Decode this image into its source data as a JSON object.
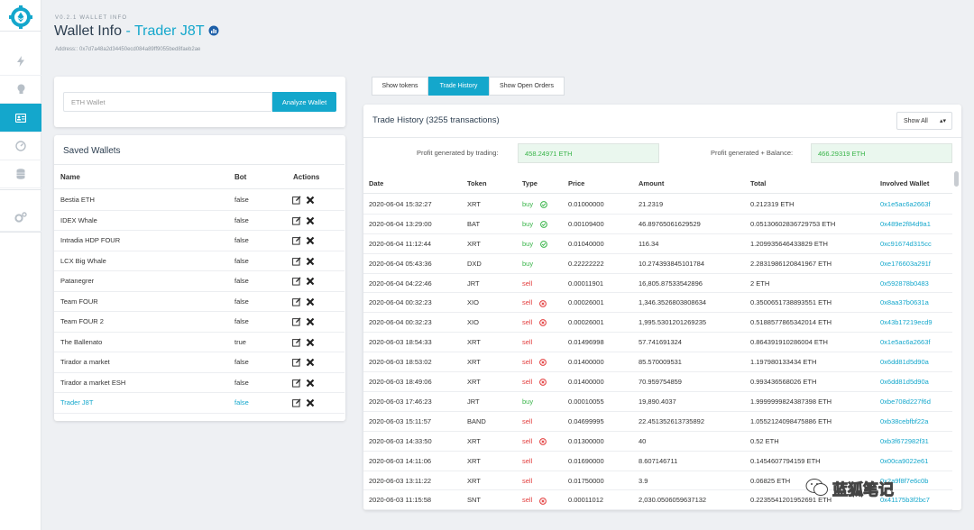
{
  "header": {
    "version": "V0.2.1 WALLET INFO",
    "title_prefix": "Wallet Info",
    "title_accent": "- Trader J8T",
    "address": "Address:: 0x7d7a48a2d34450ecd084a89ff9055bed8faeb2ae"
  },
  "sidebar": {
    "items": [
      {
        "icon": "bolt-icon"
      },
      {
        "icon": "bulb-icon"
      },
      {
        "icon": "wallet-card-icon",
        "active": true
      },
      {
        "icon": "gauge-icon"
      },
      {
        "icon": "database-icon"
      },
      {
        "icon": "gears-icon"
      }
    ]
  },
  "analyze": {
    "placeholder": "ETH Wallet",
    "button_label": "Analyze Wallet"
  },
  "saved_wallets": {
    "title": "Saved Wallets",
    "columns": [
      "Name",
      "Bot",
      "Actions"
    ],
    "rows": [
      {
        "name": "Bestia ETH",
        "bot": "false"
      },
      {
        "name": "IDEX Whale",
        "bot": "false"
      },
      {
        "name": "Intradia HDP FOUR",
        "bot": "false"
      },
      {
        "name": "LCX Big Whale",
        "bot": "false"
      },
      {
        "name": "Patanegrer",
        "bot": "false"
      },
      {
        "name": "Team FOUR",
        "bot": "false"
      },
      {
        "name": "Team FOUR 2",
        "bot": "false"
      },
      {
        "name": "The Ballenato",
        "bot": "true"
      },
      {
        "name": "Tirador a market",
        "bot": "false"
      },
      {
        "name": "Tirador a market ESH",
        "bot": "false"
      },
      {
        "name": "Trader J8T",
        "bot": "false",
        "selected": true
      }
    ]
  },
  "tabs": [
    {
      "label": "Show tokens"
    },
    {
      "label": "Trade History",
      "active": true
    },
    {
      "label": "Show Open Orders"
    }
  ],
  "trade_history": {
    "title": "Trade History (3255 transactions)",
    "filter": "Show All",
    "profit_trading_label": "Profit generated by trading:",
    "profit_trading_value": "458.24971 ETH",
    "profit_balance_label": "Profit generated + Balance:",
    "profit_balance_value": "466.29319 ETH",
    "columns": [
      "Date",
      "Token",
      "Type",
      "Price",
      "Amount",
      "Total",
      "Involved Wallet"
    ],
    "rows": [
      {
        "date": "2020-06-04 15:32:27",
        "token": "XRT",
        "type": "buy",
        "icon": "ok",
        "price": "0.01000000",
        "amount": "21.2319",
        "total": "0.212319 ETH",
        "wallet": "0x1e5ac6a2663f"
      },
      {
        "date": "2020-06-04 13:29:00",
        "token": "BAT",
        "type": "buy",
        "icon": "ok",
        "price": "0.00109400",
        "amount": "46.89765061629529",
        "total": "0.05130602836729753 ETH",
        "wallet": "0x489e2f84d9a1"
      },
      {
        "date": "2020-06-04 11:12:44",
        "token": "XRT",
        "type": "buy",
        "icon": "ok",
        "price": "0.01040000",
        "amount": "116.34",
        "total": "1.209935646433829 ETH",
        "wallet": "0xc91674d315cc"
      },
      {
        "date": "2020-06-04 05:43:36",
        "token": "DXD",
        "type": "buy",
        "icon": "",
        "price": "0.22222222",
        "amount": "10.274393845101784",
        "total": "2.2831986120841967 ETH",
        "wallet": "0xe176603a291f"
      },
      {
        "date": "2020-06-04 04:22:46",
        "token": "JRT",
        "type": "sell",
        "icon": "",
        "price": "0.00011901",
        "amount": "16,805.87533542896",
        "total": "2 ETH",
        "wallet": "0x592878b0483"
      },
      {
        "date": "2020-06-04 00:32:23",
        "token": "XIO",
        "type": "sell",
        "icon": "x",
        "price": "0.00026001",
        "amount": "1,346.3526803808634",
        "total": "0.3500651738893551 ETH",
        "wallet": "0x8aa37b0631a"
      },
      {
        "date": "2020-06-04 00:32:23",
        "token": "XIO",
        "type": "sell",
        "icon": "x",
        "price": "0.00026001",
        "amount": "1,995.5301201269235",
        "total": "0.5188577865342014 ETH",
        "wallet": "0x43b17219ecd9"
      },
      {
        "date": "2020-06-03 18:54:33",
        "token": "XRT",
        "type": "sell",
        "icon": "",
        "price": "0.01496998",
        "amount": "57.741691324",
        "total": "0.864391910286004 ETH",
        "wallet": "0x1e5ac6a2663f"
      },
      {
        "date": "2020-06-03 18:53:02",
        "token": "XRT",
        "type": "sell",
        "icon": "x",
        "price": "0.01400000",
        "amount": "85.570009531",
        "total": "1.197980133434 ETH",
        "wallet": "0x6dd81d5d90a"
      },
      {
        "date": "2020-06-03 18:49:06",
        "token": "XRT",
        "type": "sell",
        "icon": "x",
        "price": "0.01400000",
        "amount": "70.959754859",
        "total": "0.993436568026 ETH",
        "wallet": "0x6dd81d5d90a"
      },
      {
        "date": "2020-06-03 17:46:23",
        "token": "JRT",
        "type": "buy",
        "icon": "",
        "price": "0.00010055",
        "amount": "19,890.4037",
        "total": "1.9999999824387398 ETH",
        "wallet": "0xbe708d227f6d"
      },
      {
        "date": "2020-06-03 15:11:57",
        "token": "BAND",
        "type": "sell",
        "icon": "",
        "price": "0.04699995",
        "amount": "22.451352613735892",
        "total": "1.0552124098475886 ETH",
        "wallet": "0xb38cebfbf22a"
      },
      {
        "date": "2020-06-03 14:33:50",
        "token": "XRT",
        "type": "sell",
        "icon": "x",
        "price": "0.01300000",
        "amount": "40",
        "total": "0.52 ETH",
        "wallet": "0xb3f672982f31"
      },
      {
        "date": "2020-06-03 14:11:06",
        "token": "XRT",
        "type": "sell",
        "icon": "",
        "price": "0.01690000",
        "amount": "8.607146711",
        "total": "0.1454607794159 ETH",
        "wallet": "0x00ca9022e61"
      },
      {
        "date": "2020-06-03 13:11:22",
        "token": "XRT",
        "type": "sell",
        "icon": "",
        "price": "0.01750000",
        "amount": "3.9",
        "total": "0.06825 ETH",
        "wallet": "0x2a9f8f7e6c0b"
      },
      {
        "date": "2020-06-03 11:15:58",
        "token": "SNT",
        "type": "sell",
        "icon": "x",
        "price": "0.00011012",
        "amount": "2,030.0506059637132",
        "total": "0.2235541201952691 ETH",
        "wallet": "0x41175b3f2bc7"
      }
    ]
  },
  "watermark": {
    "text": "蓝狐笔记"
  },
  "colors": {
    "accent": "#14a7cc",
    "buy": "#3ab54a",
    "sell": "#e23b3b"
  }
}
